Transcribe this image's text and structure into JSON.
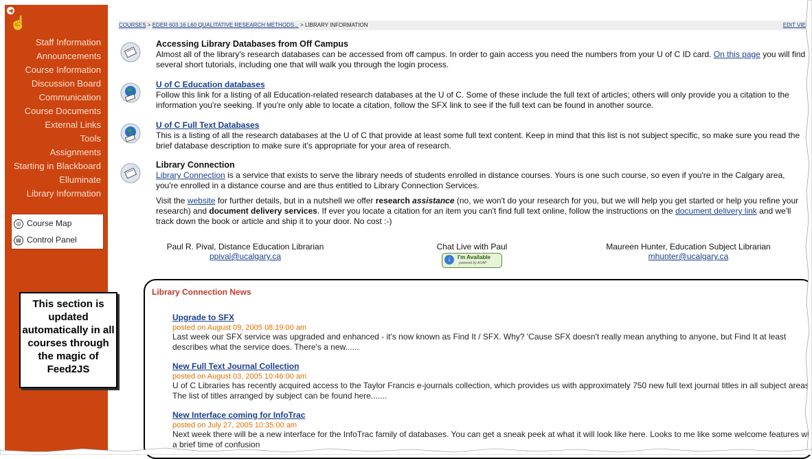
{
  "sidebar": {
    "items": [
      "Staff Information",
      "Announcements",
      "Course Information",
      "Discussion Board",
      "Communication",
      "Course Documents",
      "External Links",
      "Tools",
      "Assignments",
      "Starting in Blackboard",
      "Elluminate",
      "Library Information"
    ],
    "tools": [
      "Course Map",
      "Control Panel"
    ],
    "callout": "This section is updated automatically in all courses through the magic of Feed2JS"
  },
  "breadcrumb": {
    "courses": "COURSES",
    "sep1": ">",
    "course": "EDER 603.16 L60 QUALITATIVE RESEARCH METHODS...",
    "sep2": "> LIBRARY INFORMATION",
    "edit_view": "EDIT VIE"
  },
  "items": {
    "i1": {
      "title": "Accessing Library Databases from Off Campus",
      "text_a": "Almost all of the library's research databases can be accessed from off campus. In order to gain access you need the numbers from your U of C ID card.",
      "link": "On this page",
      "text_b": "you will find several short tutorials, including one that will walk you through the login process."
    },
    "i2": {
      "title": "U of C Education databases",
      "text": "Follow this link for a listing of all Education-related research databases at the U of C. Some of these include the full text of articles; others will only provide you a citation to the information you're seeking. If you're only able to locate a citation, follow the SFX link to see if the full text can be found in another source."
    },
    "i3": {
      "title": "U of C Full Text Databases",
      "text": "This is a listing of all the research databases at the U of C that provide at least some full text content. Keep in mind that this list is not subject specific, so make sure you read the brief database description to make sure it's appropriate for your area of research."
    },
    "i4": {
      "title": "Library Connection",
      "link": "Library Connection",
      "text": "is a service that exists to serve the library needs of students enrolled in distance courses. Yours is one such course, so even if you're in the Calgary area, you're enrolled in a distance course and are thus entitled to Library Connection Services.",
      "p2_a": "Visit the",
      "p2_link1": "website",
      "p2_b": "for further details, but in a nutshell we offer",
      "p2_bold1": "research",
      "p2_bold2": "assistance",
      "p2_c": "(no, we won't do your research for you, but we will help you get started or help you refine your research) and",
      "p2_bold3": "document delivery services",
      "p2_d": ". If ever you locate a citation for an item you can't find full text online, follow the instructions on the",
      "p2_link2": "document delivery link",
      "p2_e": "and we'll track down the book or article and ship it to your door. No cost :-)"
    }
  },
  "contacts": {
    "left_name": "Paul R. Pival, Distance Education Librarian",
    "left_email": "ppival@ucalgary.ca",
    "chat": "Chat Live with Paul",
    "badge_a": "I'm Available",
    "badge_b": "powered by ASAP",
    "right_name": "Maureen Hunter, Education Subject Librarian",
    "right_email": "mhunter@ucalgary.ca"
  },
  "news": {
    "title": "Library Connection News",
    "items": [
      {
        "headline": "Upgrade to SFX",
        "date": "posted on August 09, 2005 08:19:00 am",
        "body": "Last week our SFX service was upgraded and enhanced - it's now known as Find It / SFX. Why? 'Cause SFX doesn't really mean anything to anyone, but Find It at least describes what the service does. There's a new......"
      },
      {
        "headline": "New Full Text Journal Collection",
        "date": "posted on August 03, 2005 10:46:00 am",
        "body": "U of C Libraries has recently acquired access to the Taylor Francis e-journals collection, which provides us with approximately 750 new full text journal titles in all subject areas. The list of titles arranged by subject can be found here......."
      },
      {
        "headline": "New Interface coming for InfoTrac",
        "date": "posted on July 27, 2005 10:35:00 am",
        "body": "Next week there will be a new interface for the InfoTrac family of databases. You can get a sneak peek at what it will look like here. Looks to me like some welcome features with a brief time of confusion"
      }
    ]
  }
}
